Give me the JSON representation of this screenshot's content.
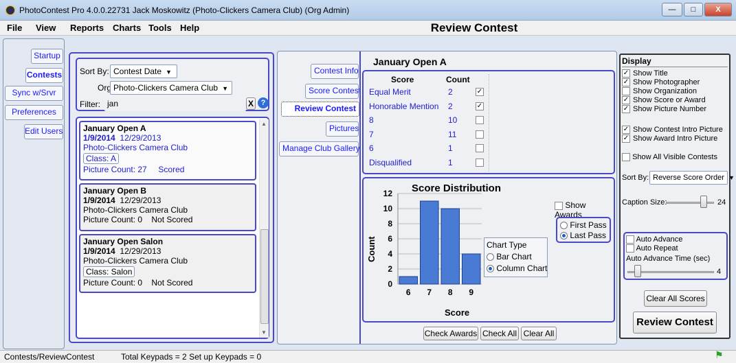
{
  "window": {
    "title": "PhotoContest Pro 4.0.0.22731 Jack Moskowitz (Photo-Clickers Camera Club) (Org Admin)",
    "minimize": "—",
    "maximize": "□",
    "close": "X"
  },
  "menu": {
    "items": [
      "File",
      "View",
      "Reports",
      "Charts",
      "Tools",
      "Help"
    ]
  },
  "page_title": "Review Contest",
  "left_nav": {
    "items": [
      "Startup",
      "Contests",
      "Sync w/Srvr",
      "Preferences",
      "Edit Users"
    ],
    "selected": "Contests"
  },
  "filters": {
    "sort_by_label": "Sort By:",
    "sort_by_value": "Contest Date",
    "org_label": "Org:",
    "org_value": "Photo-Clickers Camera Club",
    "filter_label": "Filter:",
    "filter_value": "jan",
    "clear_label": "X",
    "help_label": "?"
  },
  "contests": [
    {
      "title": "January Open A",
      "date_bold": "1/9/2014",
      "date2": "12/29/2013",
      "club": "Photo-Clickers Camera Club",
      "class": "Class: A",
      "count": "Picture Count: 27",
      "status": "Scored",
      "selected": true
    },
    {
      "title": "January Open B",
      "date_bold": "1/9/2014",
      "date2": "12/29/2013",
      "club": "Photo-Clickers Camera Club",
      "class": "",
      "count": "Picture Count: 0",
      "status": "Not Scored",
      "selected": false
    },
    {
      "title": "January Open Salon",
      "date_bold": "1/9/2014",
      "date2": "12/29/2013",
      "club": "Photo-Clickers Camera Club",
      "class": "Class: Salon",
      "count": "Picture Count: 0",
      "status": "Not Scored",
      "selected": false
    }
  ],
  "tabs": [
    "Contest Info",
    "Score Contest",
    "Review Contest",
    "Pictures",
    "Manage Club Gallery"
  ],
  "selected_tab": "Review Contest",
  "contest_name": "January Open A",
  "score_table": {
    "headers": [
      "Score",
      "Count"
    ],
    "rows": [
      {
        "score": "Equal Merit",
        "count": "2",
        "checked": true
      },
      {
        "score": "Honorable Mention",
        "count": "2",
        "checked": true
      },
      {
        "score": "8",
        "count": "10",
        "checked": false
      },
      {
        "score": "7",
        "count": "11",
        "checked": false
      },
      {
        "score": "6",
        "count": "1",
        "checked": false
      },
      {
        "score": "Disqualified",
        "count": "1",
        "checked": false
      }
    ]
  },
  "chart_data": {
    "type": "bar",
    "title": "Score Distribution",
    "xlabel": "Score",
    "ylabel": "Count",
    "categories": [
      "6",
      "7",
      "8",
      "9"
    ],
    "values": [
      1,
      11,
      10,
      4
    ],
    "ylim": [
      0,
      12
    ],
    "yticks": [
      0,
      2,
      4,
      6,
      8,
      10,
      12
    ],
    "grid": true
  },
  "chart_options": {
    "show_awards": "Show Awards",
    "pass_options": [
      "First Pass",
      "Last Pass"
    ],
    "pass_selected": "Last Pass",
    "chart_type_title": "Chart Type",
    "chart_types": [
      "Bar Chart",
      "Column Chart"
    ],
    "chart_type_selected": "Column Chart"
  },
  "bottom_buttons": [
    "Check Awards",
    "Check All",
    "Clear All"
  ],
  "display": {
    "title": "Display",
    "options1": [
      {
        "label": "Show Title",
        "checked": true
      },
      {
        "label": "Show Photographer",
        "checked": true
      },
      {
        "label": "Show Organization",
        "checked": false
      },
      {
        "label": "Show Score or Award",
        "checked": true
      },
      {
        "label": "Show Picture Number",
        "checked": true
      }
    ],
    "options2": [
      {
        "label": "Show Contest Intro Picture",
        "checked": true
      },
      {
        "label": "Show Award Intro Picture",
        "checked": true
      }
    ],
    "show_all": {
      "label": "Show All Visible Contests",
      "checked": false
    },
    "sort_by_label": "Sort By:",
    "sort_by_value": "Reverse Score Order",
    "caption_label": "Caption Size:",
    "caption_value": "24",
    "caption_level": 0.78,
    "auto_advance": "Auto Advance",
    "auto_repeat": "Auto Repeat",
    "auto_time_label": "Auto Advance Time (sec)",
    "auto_time_value": "4",
    "auto_time_level": 0.08,
    "clear_scores": "Clear All Scores",
    "review_button": "Review Contest"
  },
  "status": {
    "path": "Contests/ReviewContest",
    "keypads": "Total Keypads = 2  Set up Keypads = 0"
  }
}
